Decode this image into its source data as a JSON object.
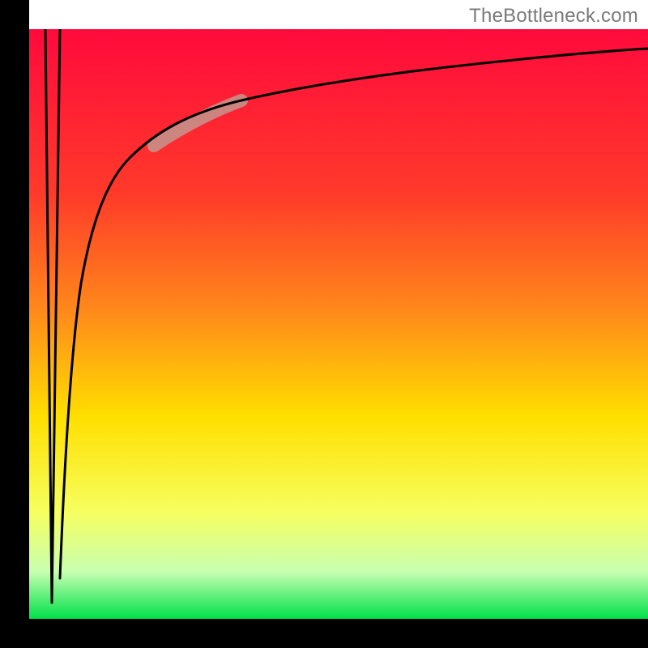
{
  "watermark": "TheBottleneck.com",
  "colors": {
    "gradient_top": "#ff0a3c",
    "gradient_mid_top": "#ff7a1f",
    "gradient_mid": "#ffe000",
    "gradient_mid_bottom": "#f6ff60",
    "gradient_bottom": "#00e04a",
    "frame": "#000000",
    "curve": "#000000",
    "highlight": "#c98a84"
  },
  "layout": {
    "frame_thickness_px": 36,
    "plot_inner_x0": 36,
    "plot_inner_y0": 36,
    "plot_inner_x1": 800,
    "plot_inner_y1": 764
  },
  "chart_data": {
    "type": "line",
    "title": "",
    "xlabel": "",
    "ylabel": "",
    "xlim": [
      0,
      100
    ],
    "ylim": [
      0,
      100
    ],
    "series": [
      {
        "name": "spike_down",
        "x": [
          5.0,
          5.9,
          6.8
        ],
        "values": [
          100,
          3,
          100
        ],
        "note": "narrow V-shaped spike falling from top to near bottom and back"
      },
      {
        "name": "log_curve",
        "x": [
          6.8,
          8,
          10,
          13,
          17,
          22,
          28,
          35,
          45,
          60,
          80,
          100
        ],
        "values": [
          7,
          30,
          50,
          63,
          73,
          80,
          85,
          88.5,
          91,
          93,
          94.5,
          95.5
        ],
        "note": "rising saturating curve toward top-right"
      }
    ],
    "highlight_segment": {
      "on_series": "log_curve",
      "x_range": [
        21,
        35
      ],
      "y_range": [
        80,
        87
      ],
      "style": "thick muted pink overlay segment"
    },
    "background_gradient": "vertical red→orange→yellow→green",
    "frame": "thick black L-shaped axes (left + bottom), no top/right edge",
    "legend": null,
    "grid": false
  }
}
